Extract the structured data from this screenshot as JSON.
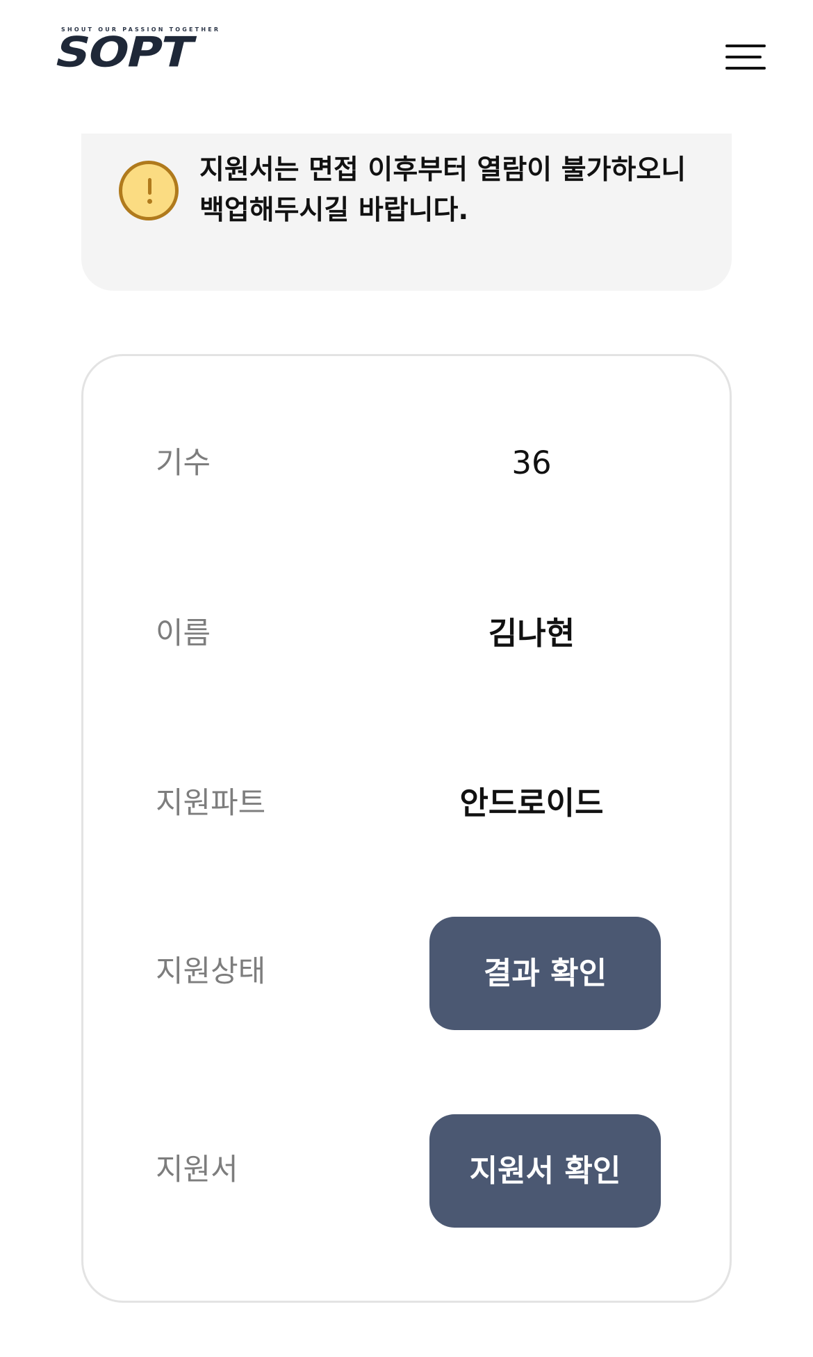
{
  "header": {
    "logo_tagline": "SHOUT OUR PASSION TOGETHER",
    "logo_text": "SOPT",
    "menu_icon": "hamburger-menu-icon"
  },
  "notice": {
    "icon": "warning-icon",
    "line1": "지원서는 면접 이후부터 열람이 불가하오니",
    "line2": "백업해두시길 바랍니다."
  },
  "info": {
    "generation_label": "기수",
    "generation_value": "36",
    "name_label": "이름",
    "name_value": "김나현",
    "part_label": "지원파트",
    "part_value": "안드로이드",
    "status_label": "지원상태",
    "status_button": "결과 확인",
    "application_label": "지원서",
    "application_button": "지원서 확인"
  },
  "colors": {
    "button_bg": "#4b5872",
    "notice_bg": "#f4f4f4",
    "warning_fill": "#fbdc82",
    "warning_stroke": "#b07a1c"
  }
}
